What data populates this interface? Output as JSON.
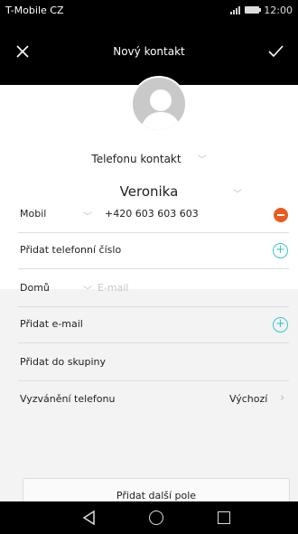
{
  "status_bar": {
    "carrier": "T-Mobile CZ",
    "time": "12:00"
  },
  "app_bar": {
    "title": "Nový kontakt",
    "close_icon": "close-icon",
    "confirm_icon": "check-icon"
  },
  "account": {
    "label": "Telefonu kontakt"
  },
  "name": {
    "value": "Veronika"
  },
  "phone": {
    "type": "Mobil",
    "number": "+420 603 603 603"
  },
  "add_phone": {
    "label": "Přidat telefonní číslo"
  },
  "email": {
    "type": "Domů",
    "placeholder": "E-mail"
  },
  "add_email": {
    "label": "Přidat e-mail"
  },
  "add_group": {
    "label": "Přidat do skupiny"
  },
  "ringtone": {
    "label": "Vyzvánění telefonu",
    "value": "Výchozí"
  },
  "more": {
    "label": "Přidat další pole"
  },
  "colors": {
    "remove": "#ea5a1f",
    "add": "#3ec5c8",
    "bar": "#000000"
  }
}
